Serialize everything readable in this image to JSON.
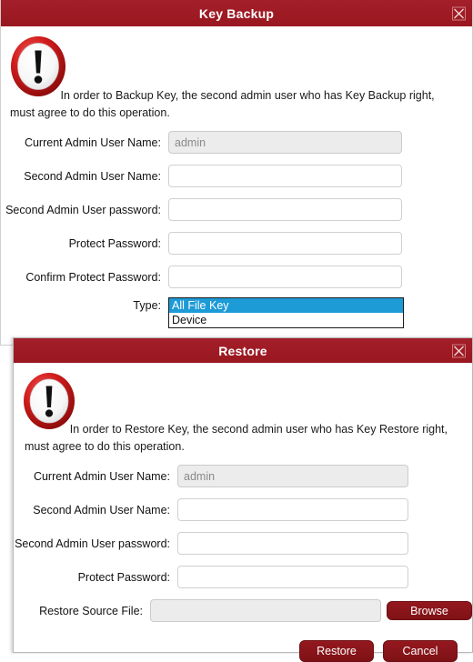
{
  "colors": {
    "titlebar_red": "#9c1b26",
    "button_red": "#8c161c",
    "select_highlight": "#1d9bd7",
    "readonly_bg": "#ececec"
  },
  "backup_dialog": {
    "title": "Key Backup",
    "close_icon": "close-icon",
    "warning_icon": "warning-exclamation-icon",
    "warning_text": "In order to Backup Key, the second admin user who has Key Backup right, must agree to do this operation.",
    "fields": [
      {
        "label": "Current Admin User Name:",
        "value": "admin",
        "placeholder": "",
        "readonly": true
      },
      {
        "label": "Second Admin User Name:",
        "value": "",
        "placeholder": "",
        "readonly": false
      },
      {
        "label": "Second Admin User password:",
        "value": "",
        "placeholder": "",
        "readonly": false
      },
      {
        "label": "Protect Password:",
        "value": "",
        "placeholder": "",
        "readonly": false
      },
      {
        "label": "Confirm Protect Password:",
        "value": "",
        "placeholder": "",
        "readonly": false
      }
    ],
    "type_row": {
      "label": "Type:",
      "options": [
        "All File Key",
        "Device"
      ],
      "selected": "All File Key"
    }
  },
  "restore_dialog": {
    "title": "Restore",
    "close_icon": "close-icon",
    "warning_icon": "warning-exclamation-icon",
    "warning_text": "In order to Restore Key, the second admin user who has Key Restore right, must agree to do this operation.",
    "fields": [
      {
        "label": "Current Admin User Name:",
        "value": "admin",
        "placeholder": "",
        "readonly": true
      },
      {
        "label": "Second Admin User Name:",
        "value": "",
        "placeholder": "",
        "readonly": false
      },
      {
        "label": "Second Admin User password:",
        "value": "",
        "placeholder": "",
        "readonly": false
      },
      {
        "label": "Protect Password:",
        "value": "",
        "placeholder": "",
        "readonly": false
      }
    ],
    "source_row": {
      "label": "Restore Source File:",
      "value": "",
      "placeholder": "",
      "browse_label": "Browse"
    },
    "buttons": {
      "confirm_label": "Restore",
      "cancel_label": "Cancel"
    }
  }
}
